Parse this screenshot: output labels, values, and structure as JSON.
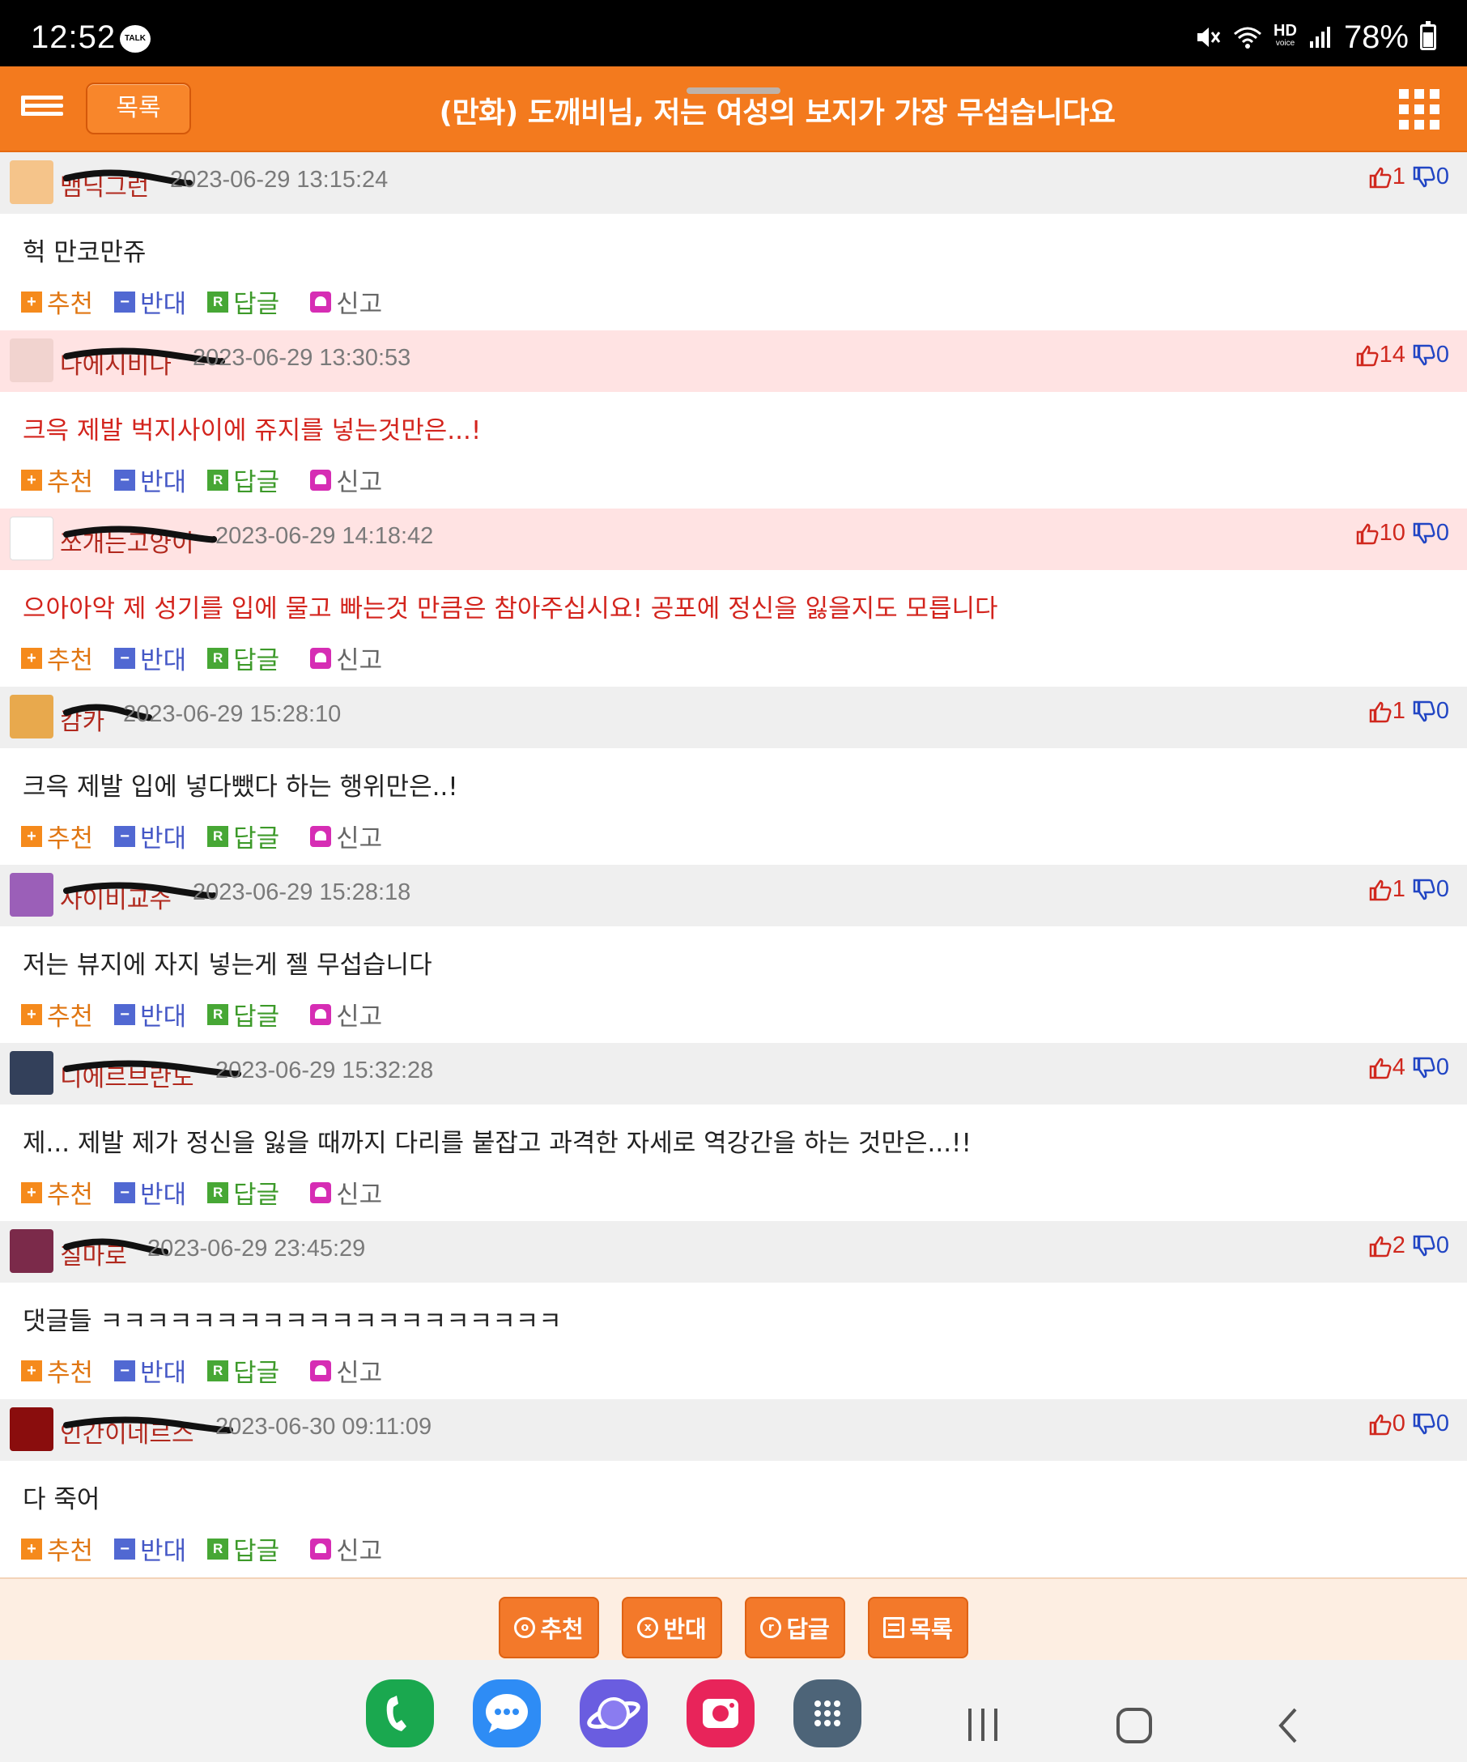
{
  "status_bar": {
    "time": "12:52",
    "talk_badge": "TALK",
    "battery": "78%",
    "hd_label": "HD",
    "hd_sub": "voice"
  },
  "header": {
    "list_button": "목록",
    "title": "(만화) 도깨비님, 저는 여성의 보지가 가장 무섭습니다요"
  },
  "action_labels": {
    "recommend": "추천",
    "oppose": "반대",
    "reply": "답글",
    "report": "신고"
  },
  "comments": [
    {
      "nick": "뱀닉그런",
      "date": "2023-06-29 13:15:24",
      "likes": "1",
      "dislikes": "0",
      "text": "헉 만코만쥬",
      "highlight": false
    },
    {
      "nick": "나에시비나",
      "date": "2023-06-29 13:30:53",
      "likes": "14",
      "dislikes": "0",
      "text": "크윽 제발 벅지사이에 쥬지를 넣는것만은...!",
      "highlight": true
    },
    {
      "nick": "쪼개는고양이",
      "date": "2023-06-29 14:18:42",
      "likes": "10",
      "dislikes": "0",
      "text": "으아아악 제 성기를 입에 물고 빠는것 만큼은 참아주십시요! 공포에 정신을 잃을지도 모릅니다",
      "highlight": true
    },
    {
      "nick": "캄카",
      "date": "2023-06-29 15:28:10",
      "likes": "1",
      "dislikes": "0",
      "text": "크윽 제발 입에 넣다뺐다 하는 행위만은..!",
      "highlight": false
    },
    {
      "nick": "사이비교주",
      "date": "2023-06-29 15:28:18",
      "likes": "1",
      "dislikes": "0",
      "text": "저는 뷰지에 자지 넣는게 젤 무섭습니다",
      "highlight": false
    },
    {
      "nick": "디에르브란도",
      "date": "2023-06-29 15:32:28",
      "likes": "4",
      "dislikes": "0",
      "text": "제... 제발 제가 정신을 잃을 때까지 다리를 붙잡고 과격한 자세로 역강간을 하는 것만은...!!",
      "highlight": false
    },
    {
      "nick": "칠마로",
      "date": "2023-06-29 23:45:29",
      "likes": "2",
      "dislikes": "0",
      "text": "댓글들 ㅋㅋㅋㅋㅋㅋㅋㅋㅋㅋㅋㅋㅋㅋㅋㅋㅋㅋㅋㅋ",
      "highlight": false
    },
    {
      "nick": "인간이네르스",
      "date": "2023-06-30 09:11:09",
      "likes": "0",
      "dislikes": "0",
      "text": "다 죽어",
      "highlight": false
    }
  ],
  "bottom_bar": {
    "recommend": "추천",
    "oppose": "반대",
    "reply": "답글",
    "list": "목록"
  },
  "dock_apps": [
    "phone-app",
    "messages-app",
    "samsung-internet-app",
    "camera-app",
    "app-drawer"
  ],
  "colors": {
    "brand_orange": "#f37a1e",
    "highlight_row": "#ffe3e3",
    "nick_red": "#b1291e",
    "like_red": "#d0281e",
    "dislike_blue": "#2246c4"
  }
}
